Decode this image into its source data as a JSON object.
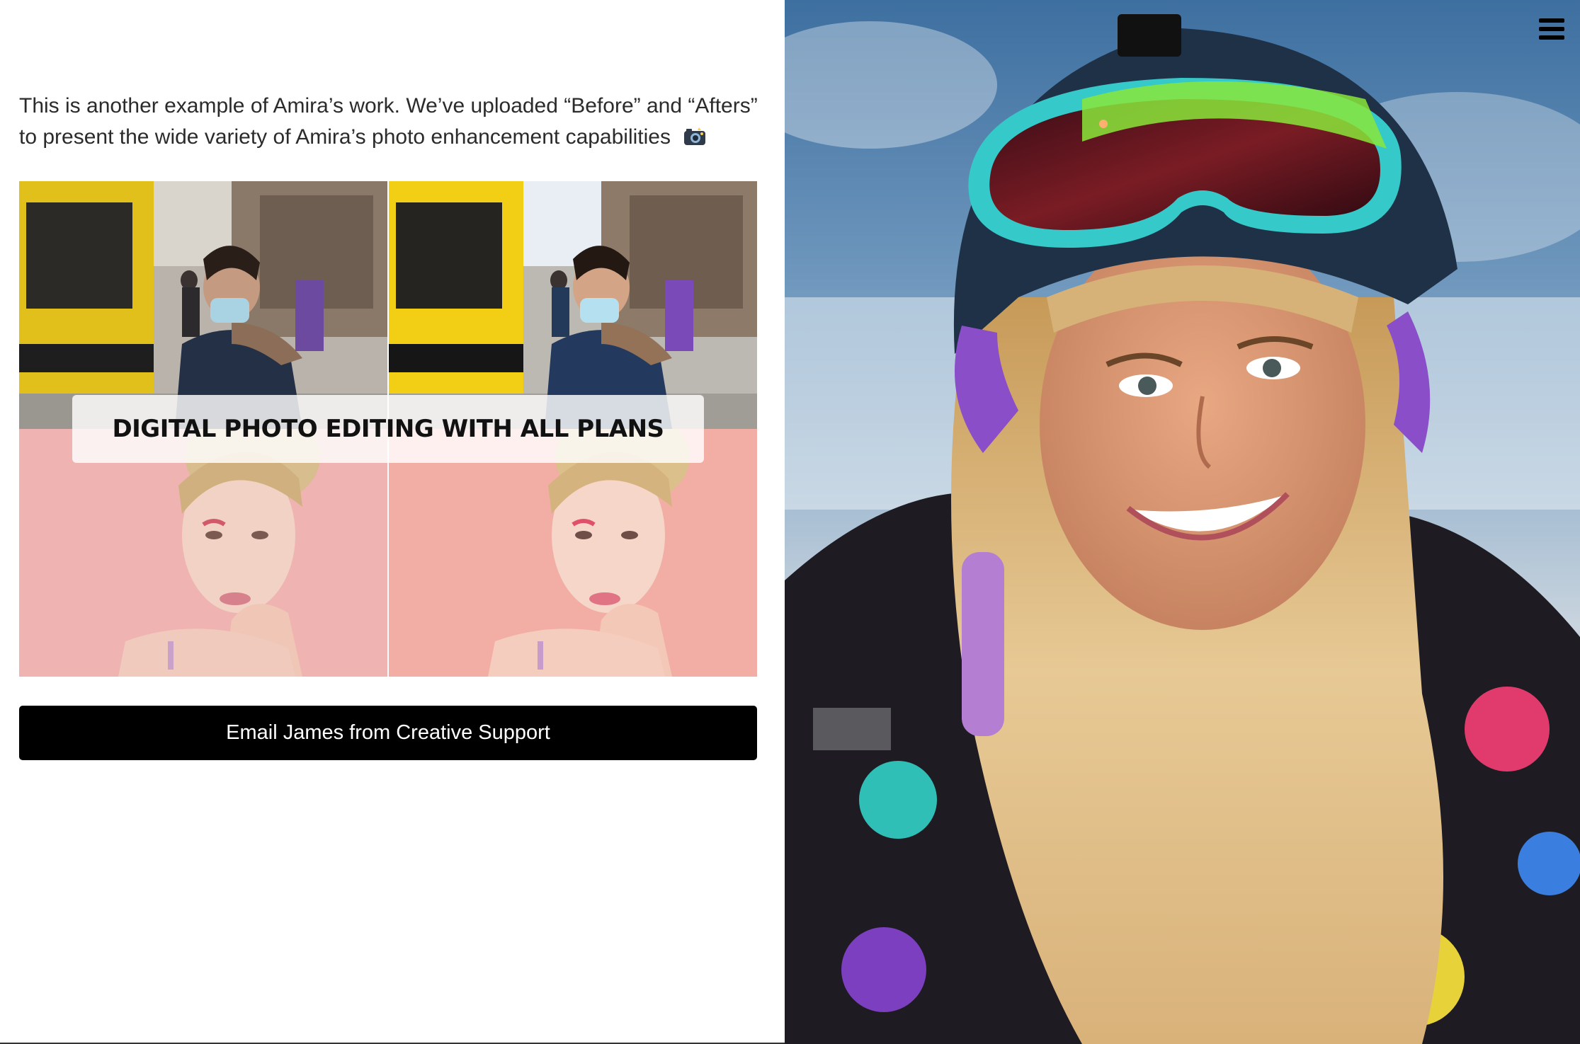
{
  "intro": {
    "text": "This is another example of Amira’s work. We’ve uploaded “Before” and “Afters” to present the wide variety of Amira’s photo enhancement capabilities",
    "emoji_icon": "camera-flash-icon"
  },
  "collage": {
    "banner_text": "DIGITAL PHOTO EDITING WITH ALL PLANS",
    "tiles": [
      {
        "name": "before-street-photo",
        "icon": "photo-icon"
      },
      {
        "name": "after-street-photo",
        "icon": "photo-icon"
      },
      {
        "name": "before-portrait-photo",
        "icon": "photo-icon"
      },
      {
        "name": "after-portrait-photo",
        "icon": "photo-icon"
      }
    ]
  },
  "cta": {
    "label": "Email James from Creative Support"
  },
  "hero": {
    "icon": "photo-icon"
  },
  "menu": {
    "icon": "hamburger-menu-icon"
  },
  "colors": {
    "button_bg": "#000000",
    "button_text": "#ffffff",
    "body_text": "#2b2b2b",
    "portrait_bg": "#f2b3b0",
    "bus_yellow": "#f2c418"
  }
}
